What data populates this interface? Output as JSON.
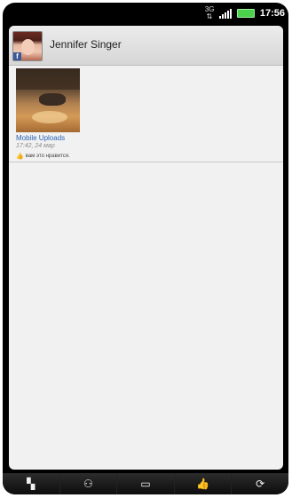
{
  "status": {
    "network": "3G",
    "time": "17:56"
  },
  "header": {
    "name": "Jennifer Singer"
  },
  "post": {
    "album": "Mobile Uploads",
    "meta": "17:42, 24 мар",
    "likes": "вам это нравится."
  },
  "toolbar": {
    "items": [
      {
        "icon": "conversation-icon"
      },
      {
        "icon": "share-icon"
      },
      {
        "icon": "comment-icon"
      },
      {
        "icon": "like-icon"
      },
      {
        "icon": "refresh-icon"
      }
    ]
  }
}
